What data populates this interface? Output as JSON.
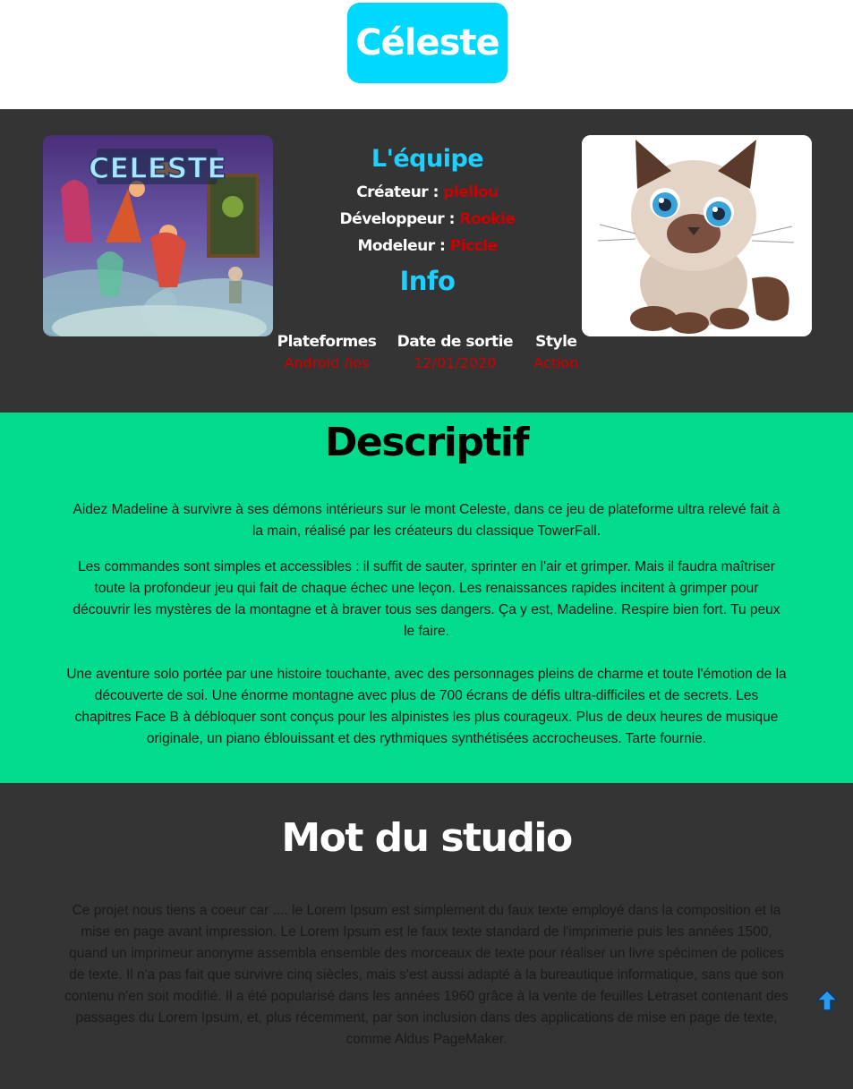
{
  "header": {
    "title": "Céleste"
  },
  "hero": {
    "cover_logo_text": "CELESTE",
    "team": {
      "title": "L'équipe",
      "members": [
        {
          "role": "Créateur :",
          "name": "piellou"
        },
        {
          "role": "Développeur :",
          "name": "Rookie"
        },
        {
          "role": "Modeleur :",
          "name": "Piccle"
        }
      ]
    },
    "info": {
      "title": "Info",
      "columns": [
        {
          "label": "Plateformes",
          "value": "Android /ios"
        },
        {
          "label": "Date de sortie",
          "value": "12/01/2020"
        },
        {
          "label": "Style",
          "value": "Action"
        }
      ]
    }
  },
  "descriptif": {
    "title": "Descriptif",
    "paragraphs": [
      "Aidez Madeline à survivre à ses démons intérieurs sur le mont Celeste, dans ce jeu de plateforme ultra relevé fait à la main, réalisé par les créateurs du classique TowerFall.",
      "Les commandes sont simples et accessibles : il suffit de sauter, sprinter en l'air et grimper. Mais il faudra maîtriser toute la profondeur jeu qui fait de chaque échec une leçon. Les renaissances rapides incitent à grimper pour découvrir les mystères de la montagne et à braver tous ses dangers. Ça y est, Madeline. Respire bien fort. Tu peux le faire.",
      "Une aventure solo portée par une histoire touchante, avec des personnages pleins de charme et toute l'émotion de la découverte de soi. Une énorme montagne avec plus de 700 écrans de défis ultra-difficiles et de secrets. Les chapitres Face B à débloquer sont conçus pour les alpinistes les plus courageux. Plus de deux heures de musique originale, un piano éblouissant et des rythmiques synthétisées accrocheuses. Tarte fournie."
    ]
  },
  "studio": {
    "title": "Mot du studio",
    "text": "Ce projet nous tiens a coeur car .... le Lorem Ipsum est simplement du faux texte employé dans la composition et la mise en page avant impression. Le Lorem Ipsum est le faux texte standard de l'imprimerie puis les années 1500, quand un imprimeur anonyme assembla ensemble des morceaux de texte pour réaliser un livre spécimen de polices de texte. Il n'a pas fait que survivre cinq siècles, mais s'est aussi adapté à la bureautique informatique, sans que son contenu n'en soit modifié. Il a été popularisé dans les années 1960 grâce à la vente de feuilles Letraset contenant des passages du Lorem Ipsum, et, plus récemment, par son inclusion dans des applications de mise en page de texte, comme Aldus PageMaker."
  },
  "scroll_top": {
    "icon": "arrow-up-icon"
  },
  "colors": {
    "accent_cyan": "#00d8ff",
    "hero_bg": "#343434",
    "descriptif_bg": "#00dc8c",
    "value_red": "#cc0000"
  }
}
